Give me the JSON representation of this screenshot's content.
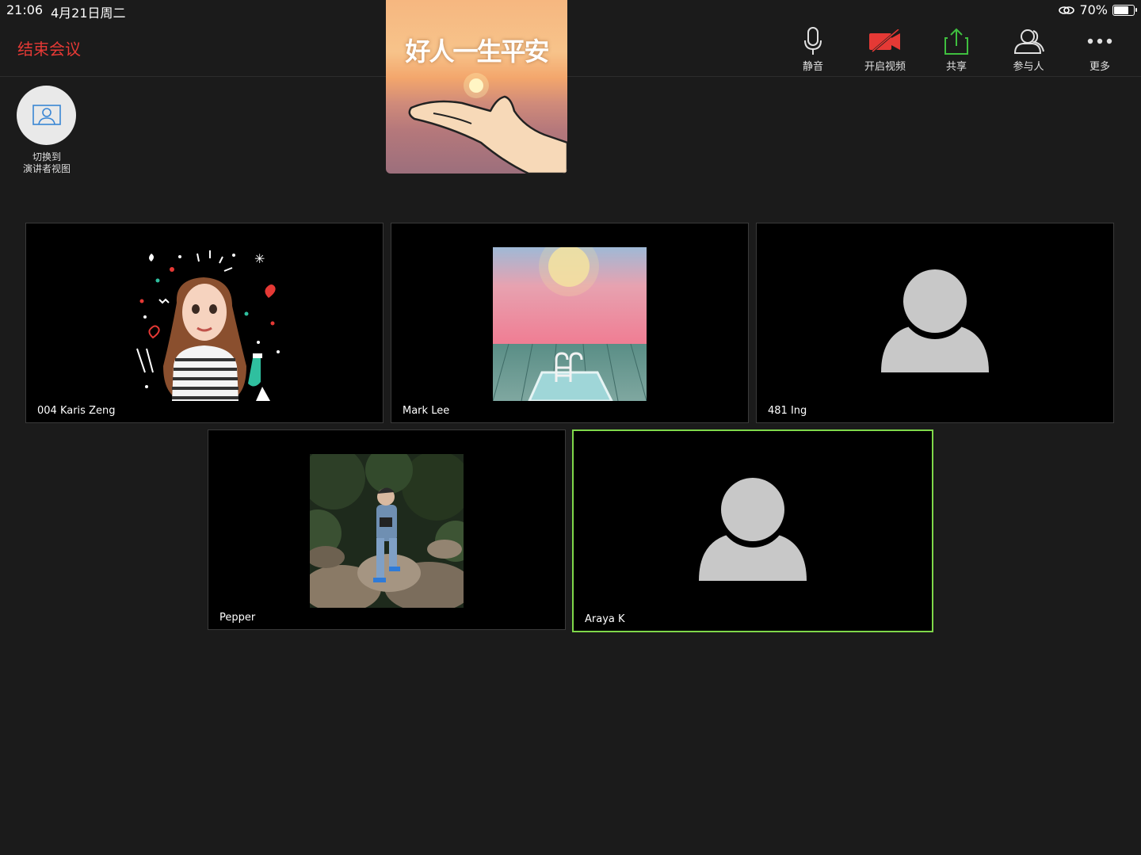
{
  "status_bar": {
    "time": "21:06",
    "date": "4月21日周二",
    "battery": "70%",
    "battery_level": 0.7
  },
  "toolbar": {
    "end_meeting": "结束会议",
    "mute": "静音",
    "start_video": "开启视频",
    "share": "共享",
    "participants": "参与人",
    "more": "更多"
  },
  "self_preview": {
    "caption": "好人一生平安"
  },
  "presenter_switch": {
    "line1": "切换到",
    "line2": "演讲者视图"
  },
  "participants": [
    {
      "name": "004 Karis Zeng"
    },
    {
      "name": "Mark Lee"
    },
    {
      "name": "481 Ing"
    },
    {
      "name": "Pepper"
    },
    {
      "name": "Araya K"
    }
  ],
  "colors": {
    "accent_red": "#e53935",
    "active_speaker": "#7fd84a",
    "share_green": "#3fbf3f",
    "video_off_red": "#e53935"
  }
}
